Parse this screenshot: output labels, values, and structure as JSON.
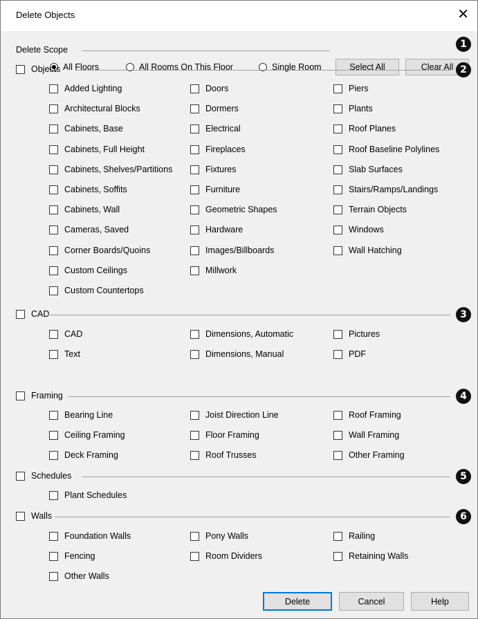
{
  "window": {
    "title": "Delete Objects"
  },
  "scope": {
    "label": "Delete Scope",
    "options": [
      {
        "label": "All Floors",
        "selected": true
      },
      {
        "label": "All Rooms On This Floor",
        "selected": false
      },
      {
        "label": "Single Room",
        "selected": false
      }
    ],
    "select_all": "Select All",
    "clear_all": "Clear All"
  },
  "sections": {
    "objects": {
      "label": "Objects",
      "col1": [
        "Added Lighting",
        "Architectural Blocks",
        "Cabinets, Base",
        "Cabinets, Full Height",
        "Cabinets, Shelves/Partitions",
        "Cabinets, Soffits",
        "Cabinets, Wall",
        "Cameras, Saved",
        "Corner Boards/Quoins",
        "Custom Ceilings",
        "Custom Countertops"
      ],
      "col2": [
        "Doors",
        "Dormers",
        "Electrical",
        "Fireplaces",
        "Fixtures",
        "Furniture",
        "Geometric Shapes",
        "Hardware",
        "Images/Billboards",
        "Millwork"
      ],
      "col3": [
        "Piers",
        "Plants",
        "Roof Planes",
        "Roof Baseline Polylines",
        "Slab Surfaces",
        "Stairs/Ramps/Landings",
        "Terrain Objects",
        "Windows",
        "Wall Hatching"
      ]
    },
    "cad": {
      "label": "CAD",
      "col1": [
        "CAD",
        "Text"
      ],
      "col2": [
        "Dimensions, Automatic",
        "Dimensions, Manual"
      ],
      "col3": [
        "Pictures",
        "PDF"
      ]
    },
    "framing": {
      "label": "Framing",
      "col1": [
        "Bearing Line",
        "Ceiling Framing",
        "Deck Framing"
      ],
      "col2": [
        "Joist Direction Line",
        "Floor Framing",
        "Roof Trusses"
      ],
      "col3": [
        "Roof Framing",
        "Wall Framing",
        "Other Framing"
      ]
    },
    "schedules": {
      "label": "Schedules",
      "col1": [
        "Plant Schedules"
      ]
    },
    "walls": {
      "label": "Walls",
      "col1": [
        "Foundation Walls",
        "Fencing",
        "Other Walls"
      ],
      "col2": [
        "Pony Walls",
        "Room Dividers"
      ],
      "col3": [
        "Railing",
        "Retaining Walls"
      ]
    }
  },
  "badges": [
    "1",
    "2",
    "3",
    "4",
    "5",
    "6"
  ],
  "footer": {
    "delete": "Delete",
    "cancel": "Cancel",
    "help": "Help"
  }
}
